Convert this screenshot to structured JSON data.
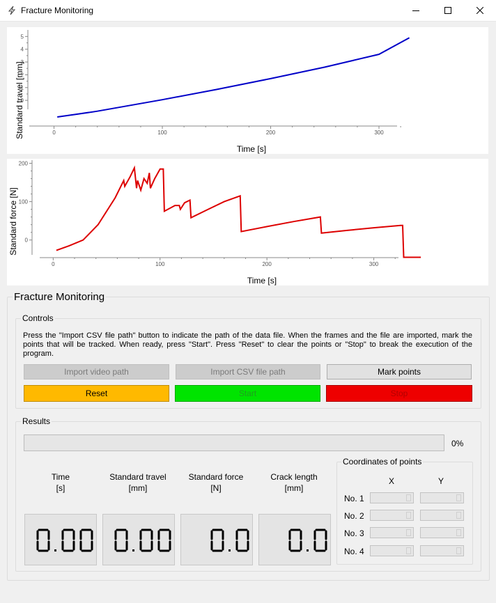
{
  "window": {
    "title": "Fracture Monitoring"
  },
  "travel_chart": {
    "ylabel": "Standard travel [mm]",
    "xlabel": "Time [s]",
    "xticks": [
      "0",
      "100",
      "200",
      "300"
    ],
    "yticks": [
      "0",
      "1",
      "2",
      "3",
      "4",
      "5"
    ]
  },
  "force_chart": {
    "ylabel": "Standard force [N]",
    "xlabel": "Time [s]",
    "xticks": [
      "0",
      "100",
      "200",
      "300"
    ],
    "yticks": [
      "0",
      "100",
      "200"
    ]
  },
  "chart_data": [
    {
      "type": "line",
      "xlabel": "Time [s]",
      "ylabel": "Standard travel [mm]",
      "xlim": [
        -10,
        327
      ],
      "ylim": [
        -1.9,
        5.4
      ],
      "color": "#0000c8",
      "x": [
        3,
        20,
        40,
        60,
        80,
        100,
        150,
        200,
        250,
        300,
        328
      ],
      "y": [
        -1.3,
        -1.1,
        -0.85,
        -0.55,
        -0.25,
        0.05,
        0.85,
        1.7,
        2.6,
        3.6,
        4.9
      ]
    },
    {
      "type": "line",
      "xlabel": "Time [s]",
      "ylabel": "Standard force [N]",
      "xlim": [
        -10,
        327
      ],
      "ylim": [
        -75,
        210
      ],
      "color": "#dd0000",
      "x": [
        3,
        15,
        28,
        42,
        58,
        66,
        67,
        72,
        76,
        78,
        79,
        82,
        85,
        88,
        90,
        91,
        95,
        100,
        103,
        104,
        114,
        118,
        119,
        123,
        128,
        129,
        145,
        160,
        175,
        176,
        200,
        225,
        250,
        251,
        275,
        300,
        325,
        326,
        327,
        328,
        344
      ],
      "y": [
        -27,
        -15,
        0,
        40,
        110,
        155,
        140,
        165,
        188,
        135,
        155,
        130,
        160,
        148,
        175,
        135,
        160,
        185,
        185,
        75,
        90,
        90,
        80,
        97,
        104,
        58,
        80,
        100,
        115,
        22,
        35,
        48,
        60,
        18,
        25,
        32,
        38,
        38,
        38,
        -45,
        -45
      ]
    }
  ],
  "panel": {
    "title": "Fracture Monitoring"
  },
  "controls": {
    "label": "Controls",
    "description": "Press the \"Import CSV file path\" button to indicate the path of the data file. When the frames and the file are imported, mark the points that will be tracked. When ready, press \"Start\". Press \"Reset\" to clear the points or \"Stop\" to break the execution of the program.",
    "import_video": "Import video path",
    "import_csv": "Import CSV file path",
    "mark_points": "Mark points",
    "reset": "Reset",
    "start": "Start",
    "stop": "Stop",
    "colors": {
      "reset": "#ffb900",
      "start": "#00e400",
      "stop": "#ee0000"
    }
  },
  "results": {
    "label": "Results",
    "progress": 0,
    "progress_text": "0%",
    "time_label": "Time",
    "time_unit": "[s]",
    "travel_label": "Standard travel",
    "travel_unit": "[mm]",
    "force_label": "Standard force",
    "force_unit": "[N]",
    "crack_label": "Crack length",
    "crack_unit": "[mm]",
    "time_value": "0.00",
    "travel_value": "0.00",
    "force_value": "0.0",
    "crack_value": "0.0"
  },
  "coordinates": {
    "label": "Coordinates of points",
    "x_header": "X",
    "y_header": "Y",
    "rows": [
      "No. 1",
      "No. 2",
      "No. 3",
      "No. 4"
    ]
  }
}
